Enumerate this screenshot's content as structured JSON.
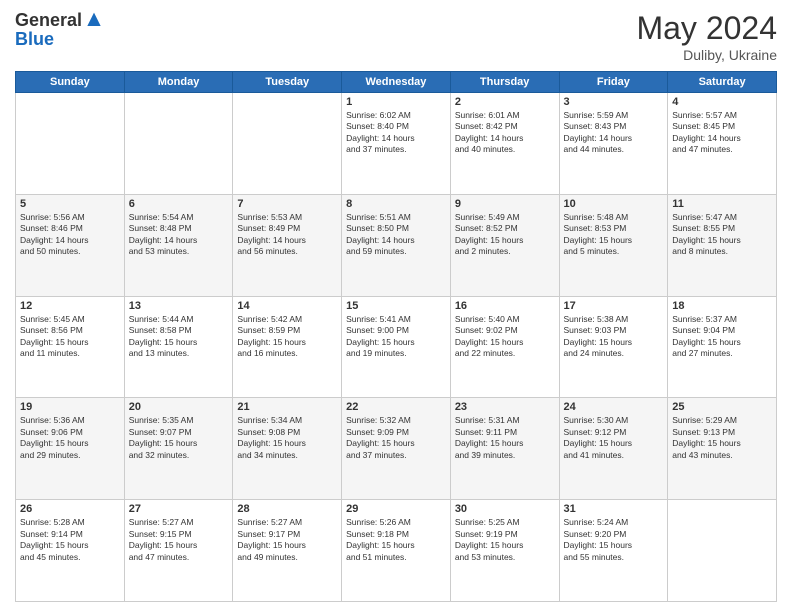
{
  "header": {
    "logo_line1": "General",
    "logo_line2": "Blue",
    "month_year": "May 2024",
    "location": "Duliby, Ukraine"
  },
  "weekdays": [
    "Sunday",
    "Monday",
    "Tuesday",
    "Wednesday",
    "Thursday",
    "Friday",
    "Saturday"
  ],
  "weeks": [
    [
      {
        "day": "",
        "info": ""
      },
      {
        "day": "",
        "info": ""
      },
      {
        "day": "",
        "info": ""
      },
      {
        "day": "1",
        "info": "Sunrise: 6:02 AM\nSunset: 8:40 PM\nDaylight: 14 hours\nand 37 minutes."
      },
      {
        "day": "2",
        "info": "Sunrise: 6:01 AM\nSunset: 8:42 PM\nDaylight: 14 hours\nand 40 minutes."
      },
      {
        "day": "3",
        "info": "Sunrise: 5:59 AM\nSunset: 8:43 PM\nDaylight: 14 hours\nand 44 minutes."
      },
      {
        "day": "4",
        "info": "Sunrise: 5:57 AM\nSunset: 8:45 PM\nDaylight: 14 hours\nand 47 minutes."
      }
    ],
    [
      {
        "day": "5",
        "info": "Sunrise: 5:56 AM\nSunset: 8:46 PM\nDaylight: 14 hours\nand 50 minutes."
      },
      {
        "day": "6",
        "info": "Sunrise: 5:54 AM\nSunset: 8:48 PM\nDaylight: 14 hours\nand 53 minutes."
      },
      {
        "day": "7",
        "info": "Sunrise: 5:53 AM\nSunset: 8:49 PM\nDaylight: 14 hours\nand 56 minutes."
      },
      {
        "day": "8",
        "info": "Sunrise: 5:51 AM\nSunset: 8:50 PM\nDaylight: 14 hours\nand 59 minutes."
      },
      {
        "day": "9",
        "info": "Sunrise: 5:49 AM\nSunset: 8:52 PM\nDaylight: 15 hours\nand 2 minutes."
      },
      {
        "day": "10",
        "info": "Sunrise: 5:48 AM\nSunset: 8:53 PM\nDaylight: 15 hours\nand 5 minutes."
      },
      {
        "day": "11",
        "info": "Sunrise: 5:47 AM\nSunset: 8:55 PM\nDaylight: 15 hours\nand 8 minutes."
      }
    ],
    [
      {
        "day": "12",
        "info": "Sunrise: 5:45 AM\nSunset: 8:56 PM\nDaylight: 15 hours\nand 11 minutes."
      },
      {
        "day": "13",
        "info": "Sunrise: 5:44 AM\nSunset: 8:58 PM\nDaylight: 15 hours\nand 13 minutes."
      },
      {
        "day": "14",
        "info": "Sunrise: 5:42 AM\nSunset: 8:59 PM\nDaylight: 15 hours\nand 16 minutes."
      },
      {
        "day": "15",
        "info": "Sunrise: 5:41 AM\nSunset: 9:00 PM\nDaylight: 15 hours\nand 19 minutes."
      },
      {
        "day": "16",
        "info": "Sunrise: 5:40 AM\nSunset: 9:02 PM\nDaylight: 15 hours\nand 22 minutes."
      },
      {
        "day": "17",
        "info": "Sunrise: 5:38 AM\nSunset: 9:03 PM\nDaylight: 15 hours\nand 24 minutes."
      },
      {
        "day": "18",
        "info": "Sunrise: 5:37 AM\nSunset: 9:04 PM\nDaylight: 15 hours\nand 27 minutes."
      }
    ],
    [
      {
        "day": "19",
        "info": "Sunrise: 5:36 AM\nSunset: 9:06 PM\nDaylight: 15 hours\nand 29 minutes."
      },
      {
        "day": "20",
        "info": "Sunrise: 5:35 AM\nSunset: 9:07 PM\nDaylight: 15 hours\nand 32 minutes."
      },
      {
        "day": "21",
        "info": "Sunrise: 5:34 AM\nSunset: 9:08 PM\nDaylight: 15 hours\nand 34 minutes."
      },
      {
        "day": "22",
        "info": "Sunrise: 5:32 AM\nSunset: 9:09 PM\nDaylight: 15 hours\nand 37 minutes."
      },
      {
        "day": "23",
        "info": "Sunrise: 5:31 AM\nSunset: 9:11 PM\nDaylight: 15 hours\nand 39 minutes."
      },
      {
        "day": "24",
        "info": "Sunrise: 5:30 AM\nSunset: 9:12 PM\nDaylight: 15 hours\nand 41 minutes."
      },
      {
        "day": "25",
        "info": "Sunrise: 5:29 AM\nSunset: 9:13 PM\nDaylight: 15 hours\nand 43 minutes."
      }
    ],
    [
      {
        "day": "26",
        "info": "Sunrise: 5:28 AM\nSunset: 9:14 PM\nDaylight: 15 hours\nand 45 minutes."
      },
      {
        "day": "27",
        "info": "Sunrise: 5:27 AM\nSunset: 9:15 PM\nDaylight: 15 hours\nand 47 minutes."
      },
      {
        "day": "28",
        "info": "Sunrise: 5:27 AM\nSunset: 9:17 PM\nDaylight: 15 hours\nand 49 minutes."
      },
      {
        "day": "29",
        "info": "Sunrise: 5:26 AM\nSunset: 9:18 PM\nDaylight: 15 hours\nand 51 minutes."
      },
      {
        "day": "30",
        "info": "Sunrise: 5:25 AM\nSunset: 9:19 PM\nDaylight: 15 hours\nand 53 minutes."
      },
      {
        "day": "31",
        "info": "Sunrise: 5:24 AM\nSunset: 9:20 PM\nDaylight: 15 hours\nand 55 minutes."
      },
      {
        "day": "",
        "info": ""
      }
    ]
  ]
}
